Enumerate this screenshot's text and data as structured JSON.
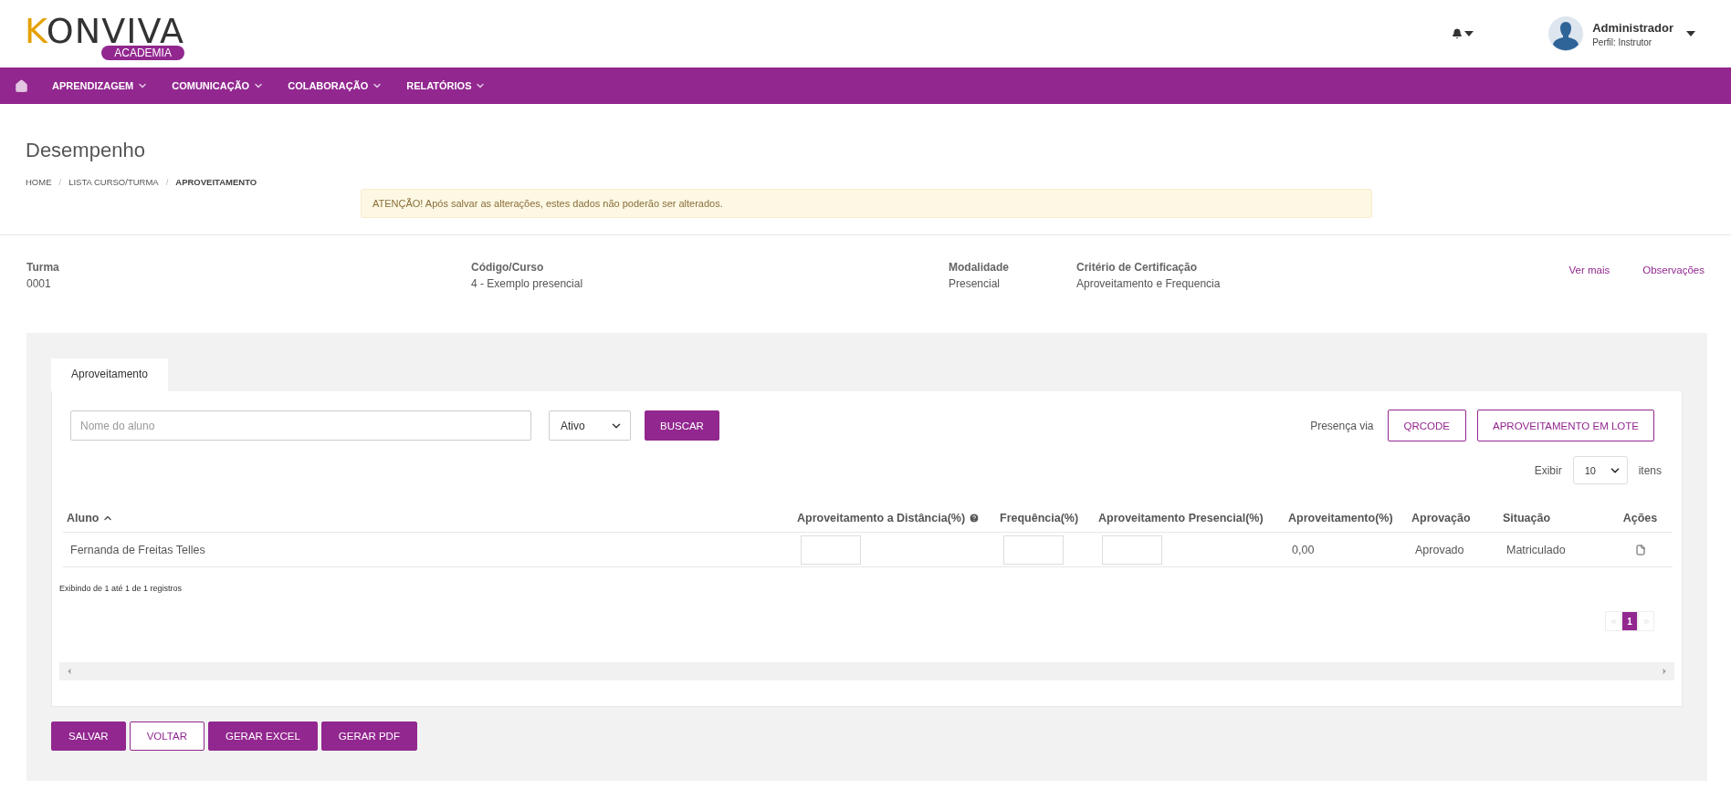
{
  "header": {
    "logo": {
      "name": "KONVIVA",
      "tag": "ACADEMIA"
    },
    "user": {
      "name": "Administrador",
      "profile": "Perfil: Instrutor"
    }
  },
  "nav": {
    "items": [
      {
        "label": "APRENDIZAGEM"
      },
      {
        "label": "COMUNICAÇÃO"
      },
      {
        "label": "COLABORAÇÃO"
      },
      {
        "label": "RELATÓRIOS"
      }
    ]
  },
  "page": {
    "title": "Desempenho",
    "separator": "/",
    "breadcrumb": [
      {
        "label": "HOME",
        "selected": false
      },
      {
        "label": "LISTA CURSO/TURMA",
        "selected": false
      },
      {
        "label": "APROVEITAMENTO",
        "selected": true
      }
    ],
    "alert": "ATENÇÃO! Após salvar as alterações, estes dados não poderão ser alterados."
  },
  "info": {
    "fields": [
      {
        "label": "Turma",
        "value": "0001"
      },
      {
        "label": "Código/Curso",
        "value": "4 - Exemplo presencial"
      },
      {
        "label": "Modalidade",
        "value": "Presencial"
      },
      {
        "label": "Critério de Certificação",
        "value": "Aproveitamento e Frequencia"
      }
    ],
    "links": [
      "Ver mais",
      "Observações"
    ]
  },
  "tabs": [
    {
      "label": "Aproveitamento",
      "selected": true
    }
  ],
  "filters": {
    "search": {
      "placeholder": "Nome do aluno"
    },
    "status": "Ativo",
    "search_button": "BUSCAR",
    "presence_label": "Presença via",
    "buttons": [
      "QRCODE",
      "APROVEITAMENTO EM LOTE"
    ],
    "page_size": {
      "before": "Exibir",
      "value": "10",
      "after": "itens"
    }
  },
  "table": {
    "columns": [
      {
        "label": "Aluno",
        "sorted": true,
        "help": false
      },
      {
        "label": "Aproveitamento a Distância(%)",
        "sorted": false,
        "help": true
      },
      {
        "label": "Frequência(%)",
        "sorted": false,
        "help": false
      },
      {
        "label": "Aproveitamento Presencial(%)",
        "sorted": false,
        "help": false
      },
      {
        "label": "Aproveitamento(%)",
        "sorted": false,
        "help": false
      },
      {
        "label": "Aprovação",
        "sorted": false,
        "help": false
      },
      {
        "label": "Situação",
        "sorted": false,
        "help": false
      },
      {
        "label": "Ações",
        "sorted": false,
        "help": false
      }
    ],
    "rows": [
      {
        "cells": [
          {
            "kind": "text",
            "text": "Fernanda de Freitas Telles"
          },
          {
            "kind": "input"
          },
          {
            "kind": "input"
          },
          {
            "kind": "input"
          },
          {
            "kind": "text",
            "text": "0,00"
          },
          {
            "kind": "text",
            "text": "Aprovado"
          },
          {
            "kind": "text",
            "text": "Matriculado"
          },
          {
            "kind": "action"
          }
        ]
      }
    ]
  },
  "summary": "Exibindo de 1 até 1 de 1 registros",
  "pagination": [
    {
      "label": "1",
      "selected": true
    }
  ],
  "actions": [
    {
      "label": "SALVAR",
      "kind": "primary"
    },
    {
      "label": "VOLTAR",
      "kind": "outline"
    },
    {
      "label": "GERAR EXCEL",
      "kind": "primary"
    },
    {
      "label": "GERAR PDF",
      "kind": "primary"
    }
  ]
}
